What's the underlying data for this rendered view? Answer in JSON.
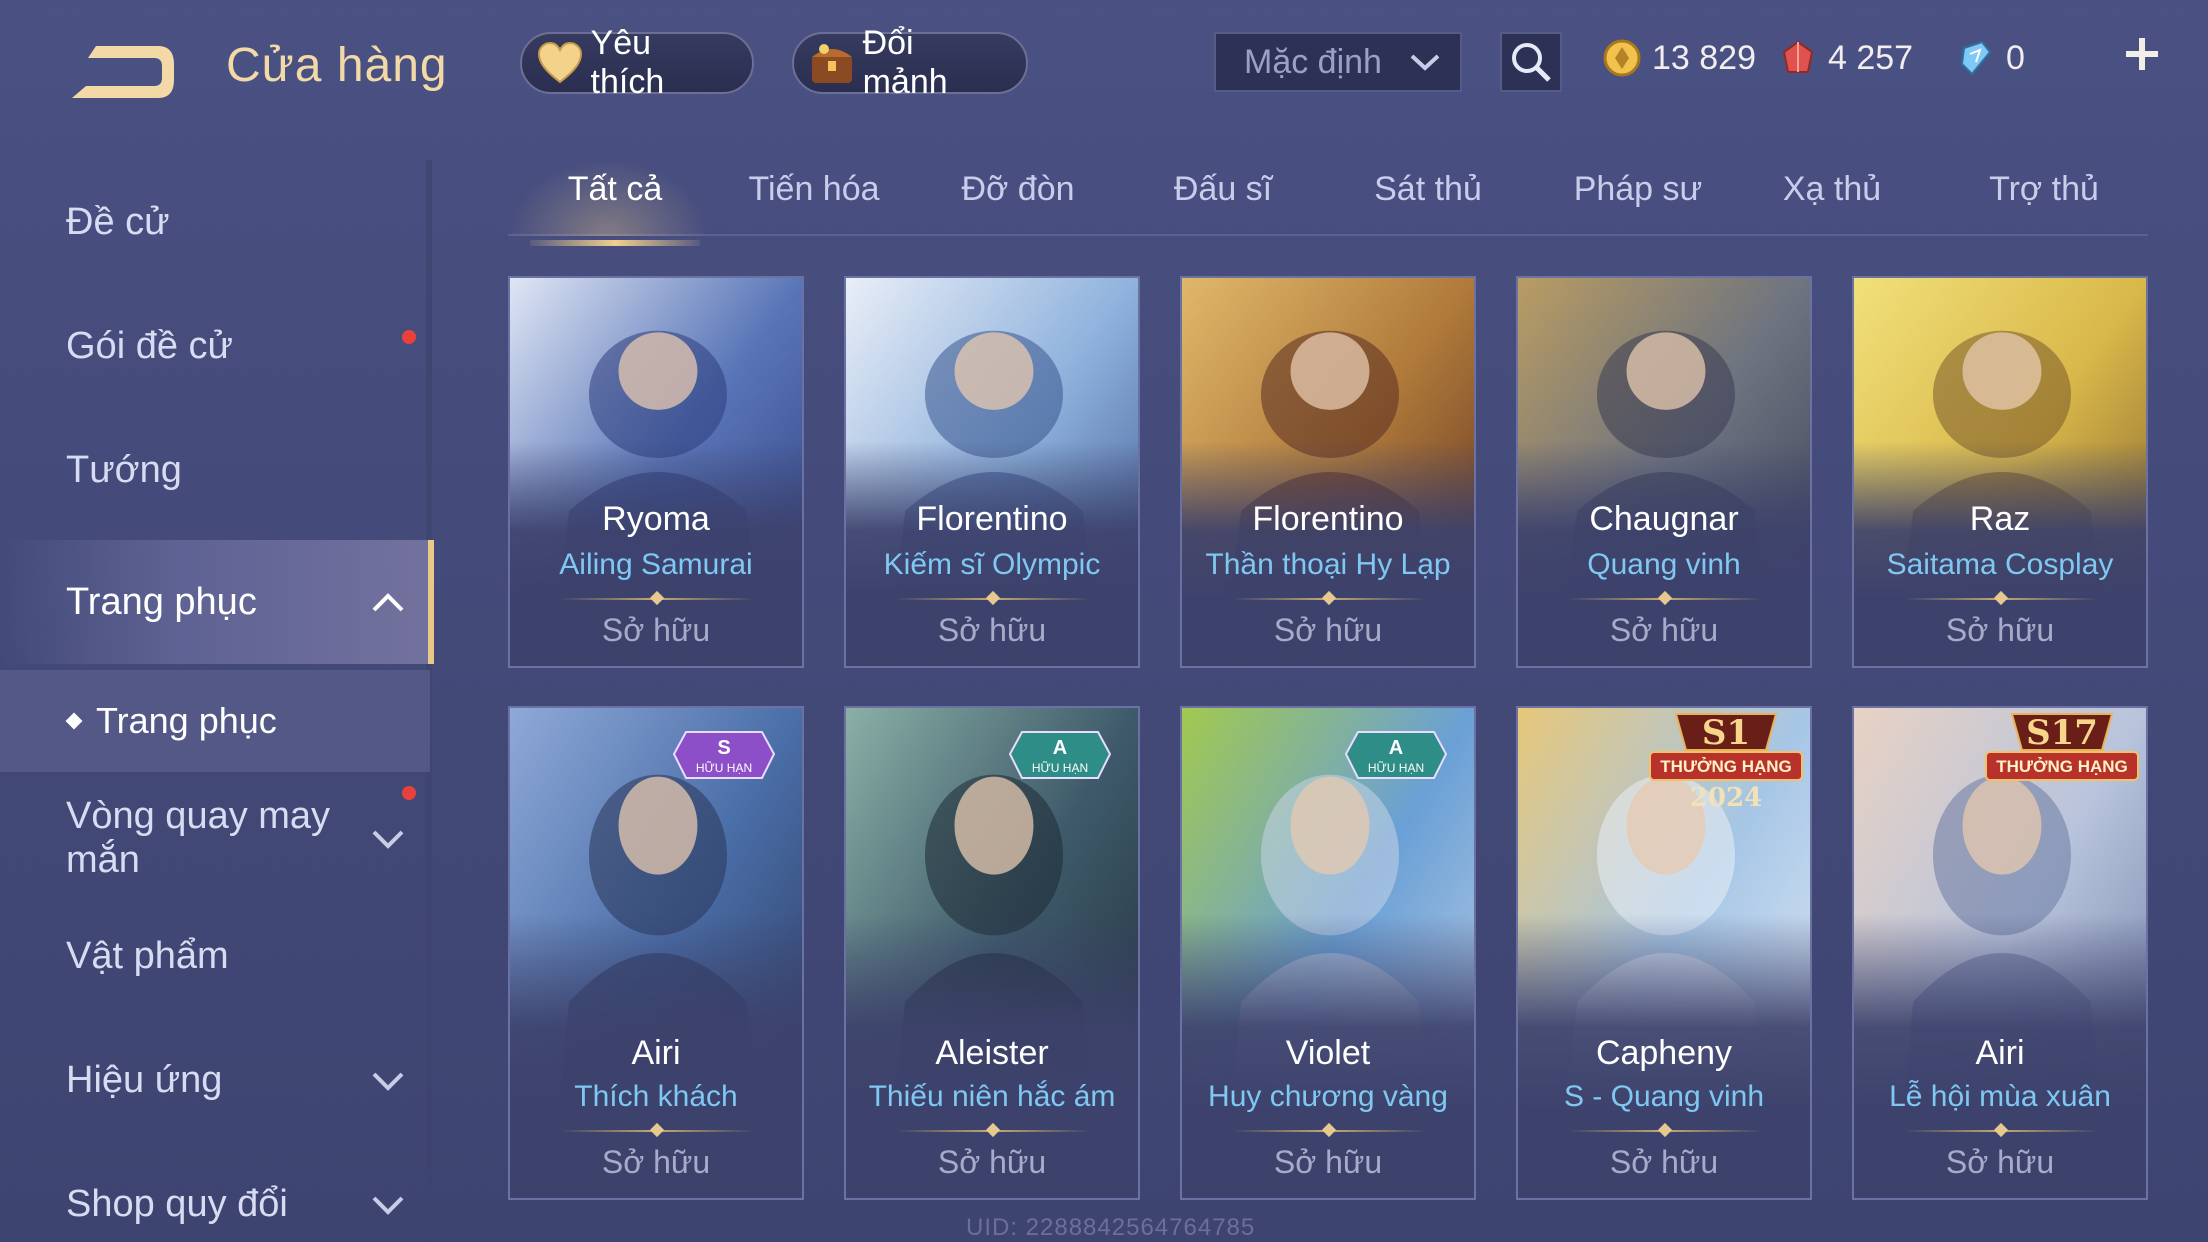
{
  "header": {
    "title": "Cửa hàng",
    "favorite_label": "Yêu thích",
    "swap_label": "Đổi mảnh",
    "sort_selected": "Mặc định",
    "currencies": [
      {
        "name": "gold",
        "value": "13 829",
        "color": "#f1c34d"
      },
      {
        "name": "voucher",
        "value": "4 257",
        "color": "#e0524d"
      },
      {
        "name": "gem",
        "value": "0",
        "color": "#7ec9f5"
      }
    ]
  },
  "sidebar": {
    "items": [
      {
        "label": "Đề cử",
        "dot": false
      },
      {
        "label": "Gói đề cử",
        "dot": true
      },
      {
        "label": "Tướng",
        "dot": false
      },
      {
        "label": "Trang phục",
        "dot": false,
        "active": true
      },
      {
        "label": "Vòng quay may mắn",
        "dot": true
      },
      {
        "label": "Vật phẩm",
        "dot": false
      },
      {
        "label": "Hiệu ứng",
        "dot": false
      },
      {
        "label": "Shop quy đổi",
        "dot": false
      }
    ],
    "sub_item": "Trang phục"
  },
  "tabs": [
    "Tất cả",
    "Tiến hóa",
    "Đỡ đòn",
    "Đấu sĩ",
    "Sát thủ",
    "Pháp sư",
    "Xạ thủ",
    "Trợ thủ"
  ],
  "active_tab": "Tất cả",
  "cards": [
    {
      "hero": "Ryoma",
      "skin": "Ailing Samurai",
      "status": "Sở hữu",
      "palette": [
        "#5a76b8",
        "#2b3c7c",
        "#dfe6f4"
      ]
    },
    {
      "hero": "Florentino",
      "skin": "Kiếm sĩ Olympic",
      "status": "Sở hữu",
      "palette": [
        "#8fb2dd",
        "#39558e",
        "#e9eef7"
      ]
    },
    {
      "hero": "Florentino",
      "skin": "Thần thoại Hy Lạp",
      "status": "Sở hữu",
      "palette": [
        "#b07a3a",
        "#5a2d22",
        "#e0b86a"
      ]
    },
    {
      "hero": "Chaugnar",
      "skin": "Quang vinh",
      "status": "Sở hữu",
      "palette": [
        "#6d7380",
        "#3a3d52",
        "#b99c62"
      ]
    },
    {
      "hero": "Raz",
      "skin": "Saitama Cosplay",
      "status": "Sở hữu",
      "palette": [
        "#d9b84a",
        "#7a5a2a",
        "#f1e07a"
      ]
    },
    {
      "hero": "Airi",
      "skin": "Thích khách",
      "status": "Sở hữu",
      "palette": [
        "#4a6ea8",
        "#2a3558",
        "#8fa9d8"
      ],
      "badge": {
        "grade": "S",
        "text": "HỮU HẠN",
        "color": "#8d4fc7"
      }
    },
    {
      "hero": "Aleister",
      "skin": "Thiếu niên hắc ám",
      "status": "Sở hữu",
      "palette": [
        "#3e5a6a",
        "#1e2a34",
        "#8ab0a6"
      ],
      "badge": {
        "grade": "A",
        "text": "HỮU HẠN",
        "color": "#2e8d86"
      }
    },
    {
      "hero": "Violet",
      "skin": "Huy chương vàng",
      "status": "Sở hữu",
      "palette": [
        "#6aa0d6",
        "#c7d4e6",
        "#a2c94e"
      ],
      "badge": {
        "grade": "A",
        "text": "HỮU HẠN",
        "color": "#2e8d86"
      }
    },
    {
      "hero": "Capheny",
      "skin": "S - Quang vinh",
      "status": "Sở hữu",
      "palette": [
        "#a6c6e6",
        "#e9eef6",
        "#e7c77a"
      ],
      "rank": {
        "season": "S1",
        "text": "THƯỞNG HẠNG",
        "year": "2024"
      }
    },
    {
      "hero": "Airi",
      "skin": "Lễ hội mùa xuân",
      "status": "Sở hữu",
      "palette": [
        "#b8c4dc",
        "#6c7aa2",
        "#e8d2c4"
      ],
      "rank": {
        "season": "S17",
        "text": "THƯỞNG HẠNG",
        "year": ""
      }
    }
  ],
  "uid": "UID: 2288842564764785"
}
